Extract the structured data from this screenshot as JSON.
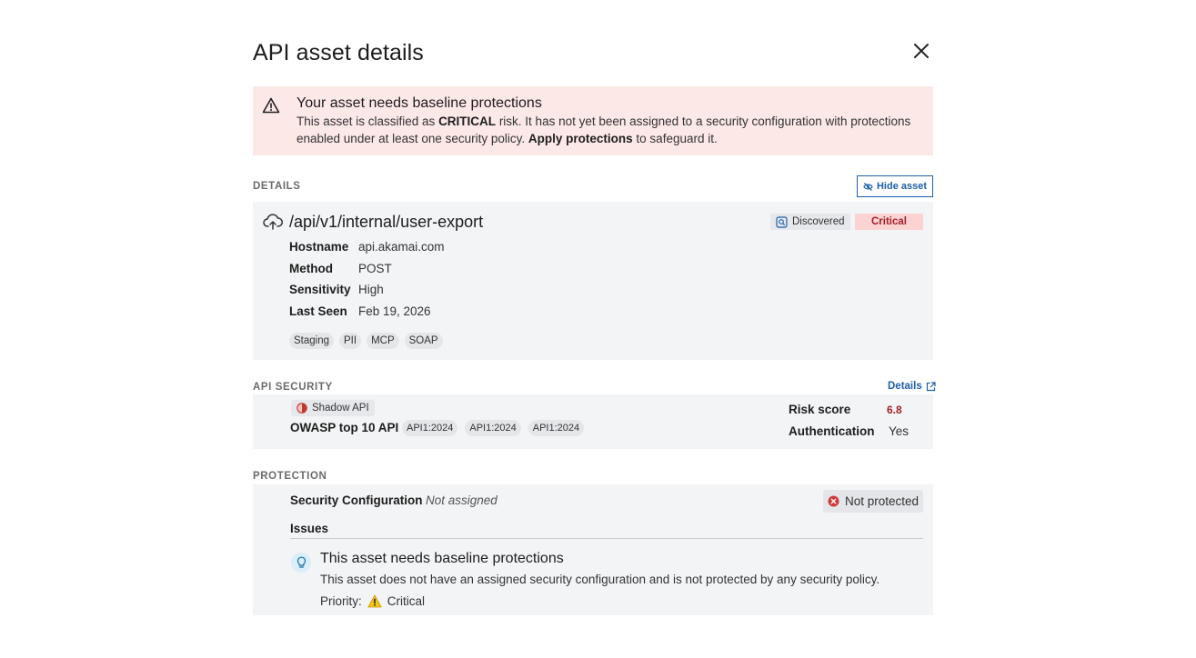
{
  "modal": {
    "title": "API asset details"
  },
  "alert": {
    "title": "Your asset needs baseline protections",
    "body_1": "This asset is classified as ",
    "body_bold_1": "CRITICAL",
    "body_2": " risk. It has not yet been assigned to a security configuration with protections enabled under at least one security policy. ",
    "body_bold_2": "Apply protections",
    "body_3": " to safeguard it."
  },
  "details": {
    "section_label": "DETAILS",
    "hide_label": "Hide asset",
    "endpoint": "/api/v1/internal/user-export",
    "discovered_label": "Discovered",
    "risk_badge": "Critical",
    "fields": [
      {
        "key": "Hostname",
        "value": "api.akamai.com"
      },
      {
        "key": "Method",
        "value": "POST"
      },
      {
        "key": "Sensitivity",
        "value": "High"
      },
      {
        "key": "Last Seen",
        "value": "Feb 19, 2026"
      }
    ],
    "tags": [
      "Staging",
      "PII",
      "MCP",
      "SOAP"
    ]
  },
  "api_security": {
    "section_label": "API SECURITY",
    "details_link": "Details",
    "shadow_label": "Shadow API",
    "owasp_label": "OWASP top 10 API",
    "owasp_tags": [
      "API1:2024",
      "API1:2024",
      "API1:2024"
    ],
    "risk_score_label": "Risk score",
    "risk_score_value": "6.8",
    "auth_label": "Authentication",
    "auth_value": "Yes"
  },
  "protection": {
    "section_label": "PROTECTION",
    "sc_label": "Security Configuration",
    "sc_value": "Not assigned",
    "status": "Not protected",
    "issues_label": "Issues",
    "issue_title": "This asset needs baseline protections",
    "issue_desc": "This asset does not have an assigned security configuration and is not protected by any security policy.",
    "priority_label": "Priority:",
    "priority_value": "Critical"
  },
  "colors": {
    "alert_bg": "#fde8e8",
    "accent": "#1f5fa8",
    "critical": "#a0212a",
    "card_bg": "#f3f4f6"
  },
  "icons": [
    "close-icon",
    "warning-icon",
    "eye-off-icon",
    "cloud-upload-icon",
    "discovered-search-icon",
    "external-link-icon",
    "shadow-api-icon",
    "error-circle-icon",
    "lightbulb-icon",
    "priority-warning-icon"
  ]
}
